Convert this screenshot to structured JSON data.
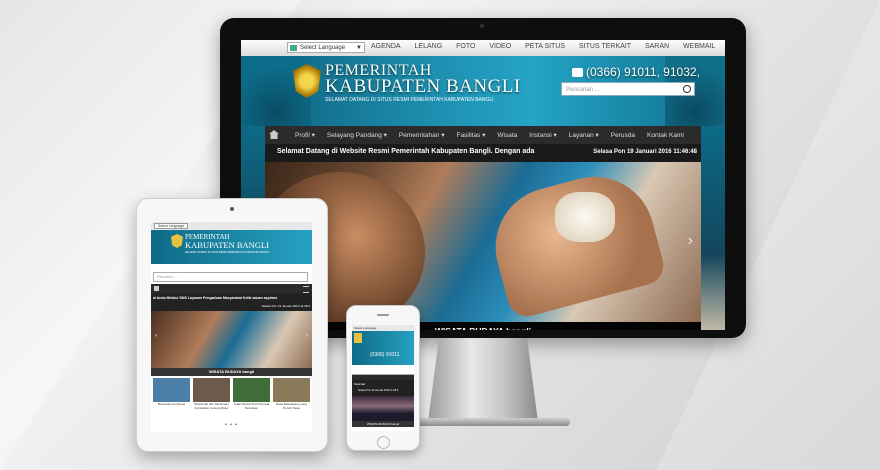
{
  "desktop": {
    "topbar": {
      "language_select": "Select Language",
      "links": [
        "AGENDA",
        "LELANG",
        "FOTO",
        "VIDEO",
        "PETA SITUS",
        "SITUS TERKAIT",
        "SARAN",
        "WEBMAIL"
      ]
    },
    "header": {
      "title_line1": "PEMERINTAH",
      "title_line2": "KABUPATEN BANGLI",
      "subtitle": "SELAMAT DATANG DI SITUS RESMI PEMERINTAH KABUPATEN BANGLI",
      "phone": "(0366) 91011, 91032,",
      "search_placeholder": "Pencarian ..."
    },
    "nav": [
      "Profil",
      "Selayang Pandang",
      "Pemerintahan",
      "Fasilitas",
      "Wisata",
      "Instansi",
      "Layanan",
      "Perusda",
      "Kontak Kami"
    ],
    "nav_dropdown": [
      true,
      true,
      true,
      true,
      false,
      true,
      true,
      false,
      false
    ],
    "ticker": {
      "message": "Selamat Datang di Website Resmi Pemerintah Kabupaten Bangli. Dengan ada",
      "datetime": "Selasa Pon 19 Januari 2016 11:46:48"
    },
    "slider": {
      "caption": "WISATA BUDAYA bangli",
      "next_icon": "chevron-right-icon"
    }
  },
  "tablet": {
    "language_select": "Select Language",
    "title_line1": "PEMERINTAH",
    "title_line2": "KABUPATEN BANGLI",
    "subtitle": "SELAMAT DATANG DI SITUS RESMI PEMERINTAH KABUPATEN BANGLI",
    "search_placeholder": "Pencarian ...",
    "ticker_message": "ai Anda Melalui SMS Layanan Pengaduan Masyarakat Ketik aduan aspirasi",
    "ticker_datetime": "Selasa Pon 19 Januari 2016 11:48:3",
    "slider_caption": "WISATA BUDAYA bangli",
    "thumbnails": [
      {
        "label": "Bereksatri ari Panas",
        "color": "#4b7fa8"
      },
      {
        "label": "Berkemah dan Menikmati Keindahan Gunung Batur",
        "color": "#6c5a4a"
      },
      {
        "label": "Jejak Historis Pura Puncak Penulisan",
        "color": "#3f6e3a"
      },
      {
        "label": "Desa Bokelasang yang Penuh Tawa",
        "color": "#8a7a5a"
      }
    ],
    "pager": "• • •"
  },
  "phone": {
    "language_select": "Select Language",
    "phone_number": "(0366) 91011",
    "ticker_message": "Selamat",
    "ticker_datetime": "Selasa Pon 19 Januari 2016 11:48:3",
    "slider_caption": "WISATA BUDAYA bangli"
  }
}
